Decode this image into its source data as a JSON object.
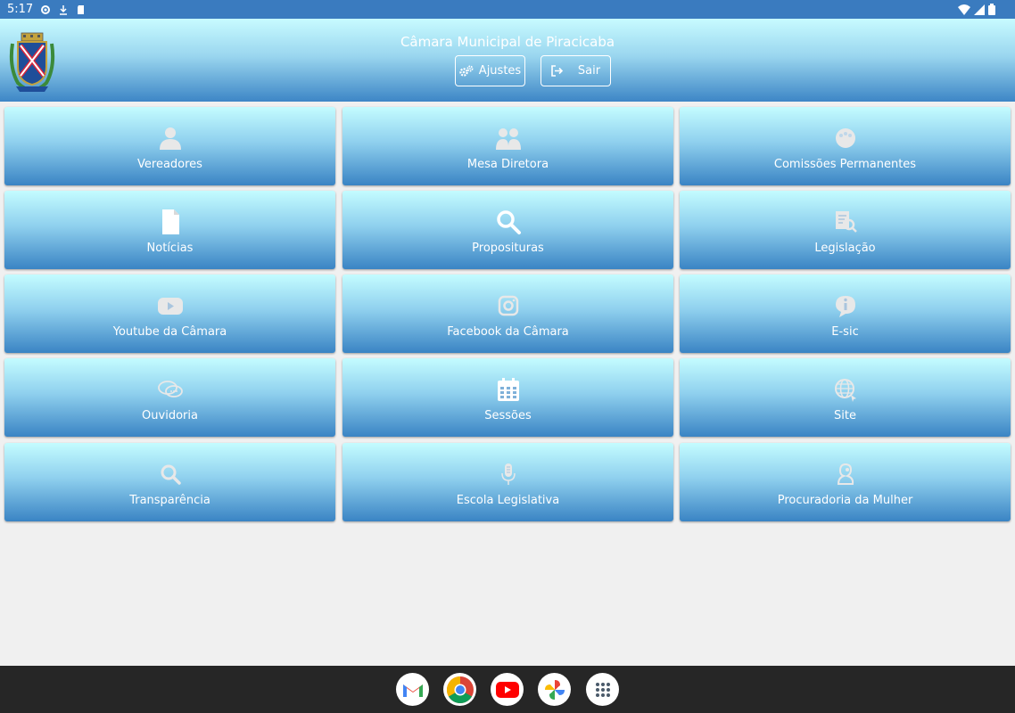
{
  "status_bar": {
    "time": "5:17",
    "left_icons": [
      "settings-icon",
      "download-icon",
      "sd-card-icon"
    ],
    "right_icons": [
      "wifi-icon",
      "signal-icon",
      "battery-icon"
    ]
  },
  "header": {
    "title": "Câmara Municipal de Piracicaba",
    "logo": "coat-of-arms-logo",
    "buttons": {
      "settings_label": "Ajustes",
      "logout_label": "Sair"
    }
  },
  "tiles": [
    {
      "label": "Vereadores",
      "icon": "person-icon"
    },
    {
      "label": "Mesa Diretora",
      "icon": "group-icon"
    },
    {
      "label": "Comissões Permanentes",
      "icon": "meeting-icon"
    },
    {
      "label": "Notícias",
      "icon": "document-icon"
    },
    {
      "label": "Proposituras",
      "icon": "search-icon"
    },
    {
      "label": "Legislação",
      "icon": "law-search-icon"
    },
    {
      "label": "Youtube da Câmara",
      "icon": "youtube-icon"
    },
    {
      "label": "Facebook da Câmara",
      "icon": "instagram-icon"
    },
    {
      "label": "E-sic",
      "icon": "info-icon"
    },
    {
      "label": "Ouvidoria",
      "icon": "chat-icon"
    },
    {
      "label": "Sessões",
      "icon": "calendar-icon"
    },
    {
      "label": "Site",
      "icon": "globe-icon"
    },
    {
      "label": "Transparência",
      "icon": "magnifier-icon"
    },
    {
      "label": "Escola Legislativa",
      "icon": "microphone-icon"
    },
    {
      "label": "Procuradoria da Mulher",
      "icon": "woman-icon"
    }
  ],
  "dock": {
    "apps": [
      "gmail-icon",
      "chrome-icon",
      "youtube-app-icon",
      "photos-icon",
      "app-drawer-icon"
    ]
  },
  "colors": {
    "status_bar": "#3a7bbf",
    "tile_top": "#c4fcff",
    "tile_bottom": "#3a84c4",
    "background": "#f0f0f0",
    "dock": "#262626"
  }
}
